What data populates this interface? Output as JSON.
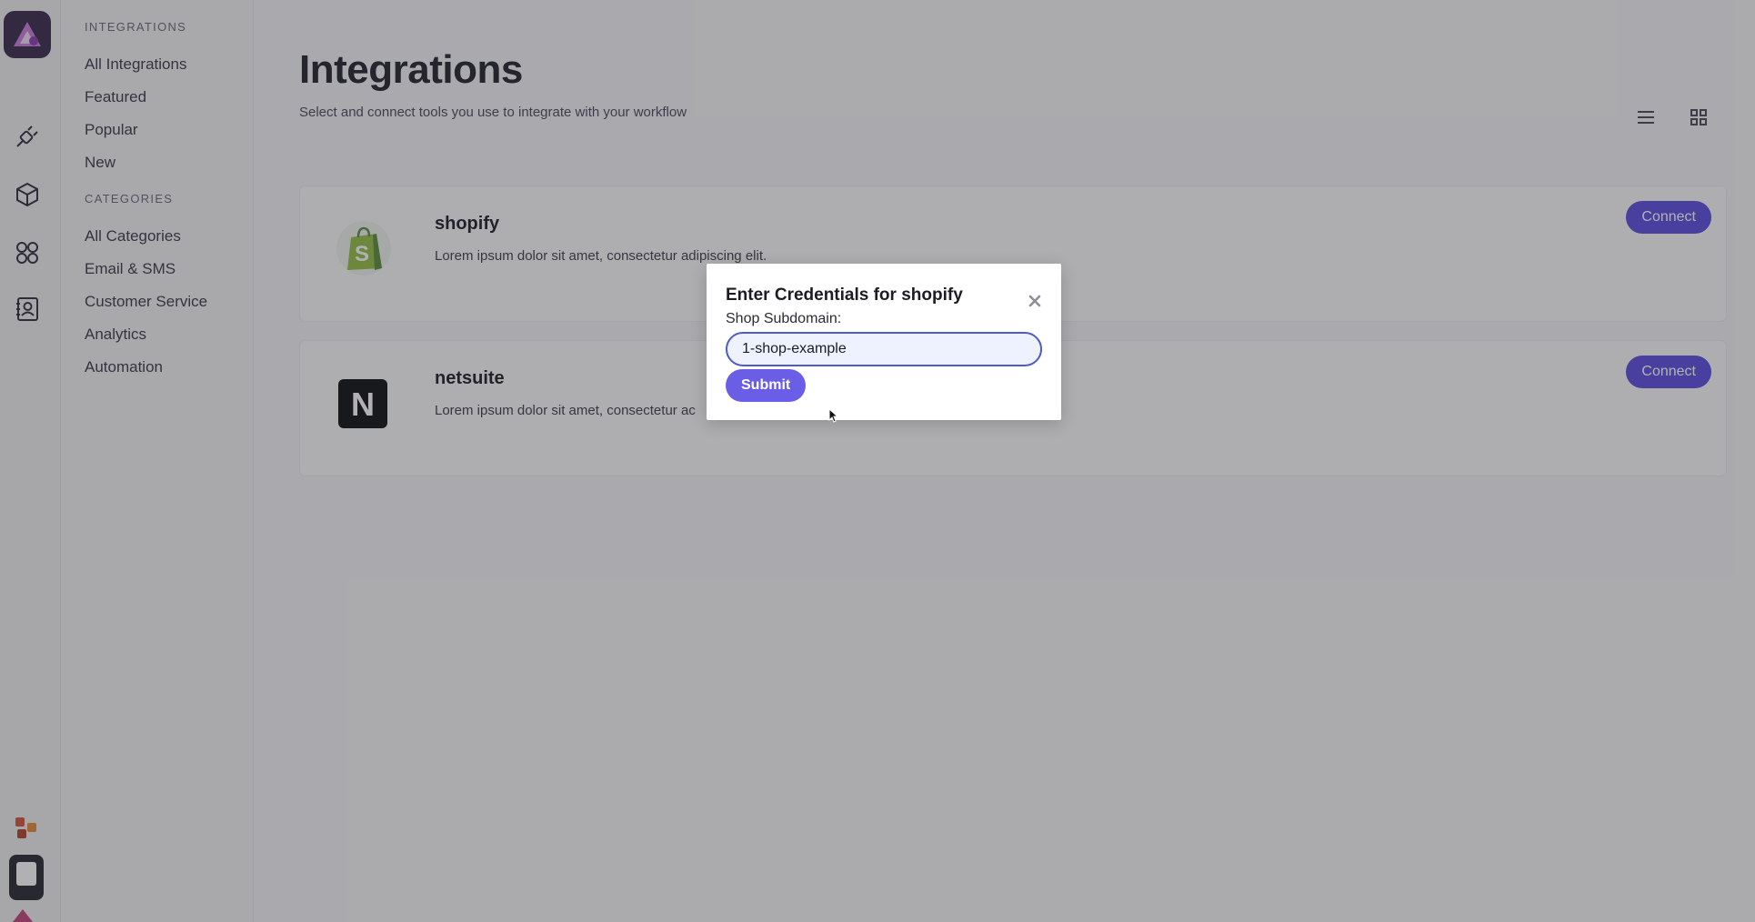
{
  "sidebar": {
    "integrations_label": "INTEGRATIONS",
    "integration_items": [
      {
        "label": "All Integrations"
      },
      {
        "label": "Featured"
      },
      {
        "label": "Popular"
      },
      {
        "label": "New"
      }
    ],
    "categories_label": "CATEGORIES",
    "category_items": [
      {
        "label": "All Categories"
      },
      {
        "label": "Email & SMS"
      },
      {
        "label": "Customer Service"
      },
      {
        "label": "Analytics"
      },
      {
        "label": "Automation"
      }
    ]
  },
  "rail": {
    "icons": [
      "plug-icon",
      "cube-icon",
      "apps-grid-icon",
      "contacts-icon"
    ]
  },
  "header": {
    "title": "Integrations",
    "subtitle": "Select and connect tools you use to integrate with your workflow"
  },
  "integrations": [
    {
      "name": "shopify",
      "description": "Lorem ipsum dolor sit amet, consectetur adipiscing elit.",
      "button": "Connect"
    },
    {
      "name": "netsuite",
      "description": "Lorem ipsum dolor sit amet, consectetur ac",
      "button": "Connect"
    }
  ],
  "modal": {
    "title": "Enter Credentials for shopify",
    "field_label": "Shop Subdomain:",
    "field_value": "1-shop-example",
    "submit_label": "Submit"
  },
  "colors": {
    "accent": "#5b4de0",
    "submit": "#6a5de6",
    "shopify_green": "#95bf47"
  }
}
